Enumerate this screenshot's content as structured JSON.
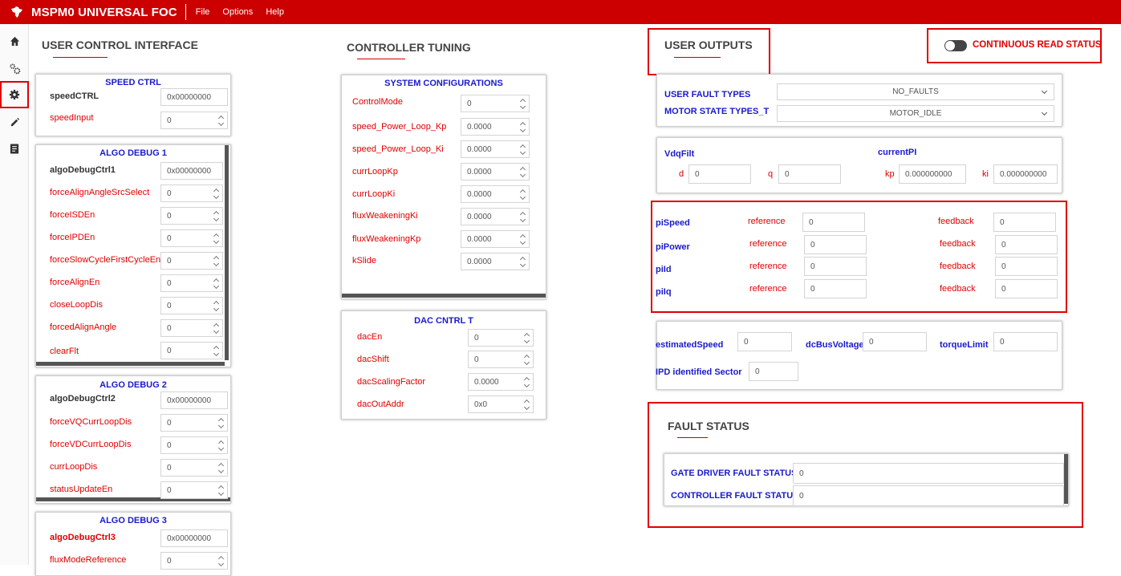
{
  "app": {
    "title": "MSPM0 UNIVERSAL FOC",
    "menu": [
      "File",
      "Options",
      "Help"
    ]
  },
  "sidebar": {
    "icons": [
      "home-icon",
      "settings-dual-icon",
      "gear-icon",
      "pencil-icon",
      "document-icon"
    ]
  },
  "sections": {
    "user_control": "USER CONTROL INTERFACE",
    "controller_tuning": "CONTROLLER TUNING",
    "user_outputs": "USER OUTPUTS",
    "fault_status": "FAULT STATUS",
    "continuous_read": "CONTINUOUS READ STATUS"
  },
  "speed_ctrl": {
    "title": "SPEED CTRL",
    "rows": [
      {
        "label": "speedCTRL",
        "value": "0x00000000"
      },
      {
        "label": "speedInput",
        "value": "0"
      }
    ]
  },
  "algo1": {
    "title": "ALGO DEBUG 1",
    "rows": [
      {
        "label": "algoDebugCtrl1",
        "value": "0x00000000"
      },
      {
        "label": "forceAlignAngleSrcSelect",
        "value": "0"
      },
      {
        "label": "forceISDEn",
        "value": "0"
      },
      {
        "label": "forceIPDEn",
        "value": "0"
      },
      {
        "label": "forceSlowCycleFirstCycleEn",
        "value": "0"
      },
      {
        "label": "forceAlignEn",
        "value": "0"
      },
      {
        "label": "closeLoopDis",
        "value": "0"
      },
      {
        "label": "forcedAlignAngle",
        "value": "0"
      },
      {
        "label": "clearFlt",
        "value": "0"
      }
    ]
  },
  "algo2": {
    "title": "ALGO DEBUG 2",
    "rows": [
      {
        "label": "algoDebugCtrl2",
        "value": "0x00000000"
      },
      {
        "label": "forceVQCurrLoopDis",
        "value": "0"
      },
      {
        "label": "forceVDCurrLoopDis",
        "value": "0"
      },
      {
        "label": "currLoopDis",
        "value": "0"
      },
      {
        "label": "statusUpdateEn",
        "value": "0"
      }
    ]
  },
  "algo3": {
    "title": "ALGO DEBUG 3",
    "rows": [
      {
        "label": "algoDebugCtrl3",
        "value": "0x00000000"
      },
      {
        "label": "fluxModeReference",
        "value": "0"
      }
    ]
  },
  "sysconf": {
    "title": "SYSTEM CONFIGURATIONS",
    "rows": [
      {
        "label": "ControlMode",
        "value": "0"
      },
      {
        "label": "speed_Power_Loop_Kp",
        "value": "0.0000"
      },
      {
        "label": "speed_Power_Loop_Ki",
        "value": "0.0000"
      },
      {
        "label": "currLoopKp",
        "value": "0.0000"
      },
      {
        "label": "currLoopKi",
        "value": "0.0000"
      },
      {
        "label": "fluxWeakeningKi",
        "value": "0.0000"
      },
      {
        "label": "fluxWeakeningKp",
        "value": "0.0000"
      },
      {
        "label": "kSlide",
        "value": "0.0000"
      }
    ]
  },
  "dac": {
    "title": "DAC CNTRL T",
    "rows": [
      {
        "label": "dacEn",
        "value": "0"
      },
      {
        "label": "dacShift",
        "value": "0"
      },
      {
        "label": "dacScalingFactor",
        "value": "0.0000"
      },
      {
        "label": "dacOutAddr",
        "value": "0x0"
      }
    ]
  },
  "outputs": {
    "fault_types_label": "USER FAULT TYPES",
    "fault_types_value": "NO_FAULTS",
    "motor_state_label": "MOTOR STATE TYPES_T",
    "motor_state_value": "MOTOR_IDLE",
    "vdqfilt": "VdqFilt",
    "currentpi": "currentPI",
    "d_label": "d",
    "d_value": "0",
    "q_label": "q",
    "q_value": "0",
    "kp_label": "kp",
    "kp_value": "0.000000000",
    "ki_label": "ki",
    "ki_value": "0.000000000",
    "pi_rows": [
      {
        "name": "piSpeed",
        "ref_label": "reference",
        "ref": "0",
        "fb_label": "feedback",
        "fb": "0"
      },
      {
        "name": "piPower",
        "ref_label": "reference",
        "ref": "0",
        "fb_label": "feedback",
        "fb": "0"
      },
      {
        "name": "piId",
        "ref_label": "reference",
        "ref": "0",
        "fb_label": "feedback",
        "fb": "0"
      },
      {
        "name": "piIq",
        "ref_label": "reference",
        "ref": "0",
        "fb_label": "feedback",
        "fb": "0"
      }
    ],
    "estimated_speed_label": "estimatedSpeed",
    "estimated_speed": "0",
    "dcbus_label": "dcBusVoltage",
    "dcbus": "0",
    "torque_label": "torqueLimit",
    "torque": "0",
    "ipd_label": "IPD identified Sector",
    "ipd": "0"
  },
  "fault": {
    "gate_label": "GATE DRIVER FAULT STATUS",
    "gate": "0",
    "ctrl_label": "CONTROLLER FAULT STATUS",
    "ctrl": "0"
  },
  "colors": {
    "brand": "#cc0000",
    "accent_blue": "#1a1acc",
    "label_red": "#e00000"
  }
}
